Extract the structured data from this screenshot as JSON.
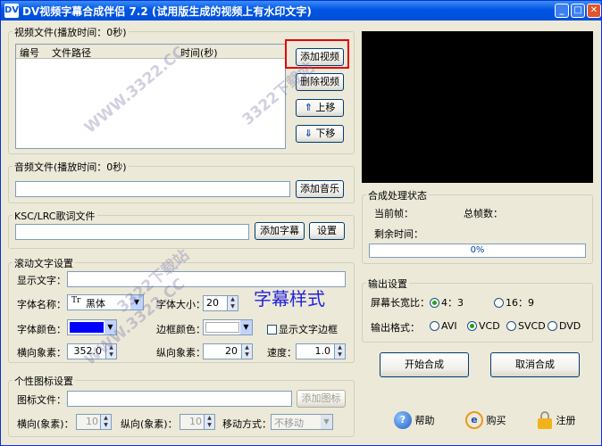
{
  "window": {
    "title": "DV视频字幕合成伴侣 7.2 (试用版生成的视频上有水印文字)",
    "min": "_",
    "max": "□",
    "close": "✕"
  },
  "video": {
    "legend": "视频文件(播放时间：0秒)",
    "col_num": "编号",
    "col_path": "文件路径",
    "col_time": "时间(秒)",
    "add": "添加视频",
    "del": "删除视频",
    "up": "上移",
    "down": "下移",
    "up_glyph": "⇑",
    "down_glyph": "⇓"
  },
  "audio": {
    "legend": "音频文件(播放时间：0秒)",
    "path": "",
    "add": "添加音乐"
  },
  "lrc": {
    "legend": "KSC/LRC歌词文件",
    "path": "",
    "add": "添加字幕",
    "settings": "设置"
  },
  "scroll": {
    "legend": "滚动文字设置",
    "text_label": "显示文字：",
    "text": "",
    "font_name_label": "字体名称：",
    "font_name": "黑体",
    "font_size_label": "字体大小：",
    "font_size": "20",
    "preview": "字幕样式",
    "font_color_label": "字体颜色：",
    "font_color": "#0000ff",
    "border_color_label": "边框颜色：",
    "border_color": "#ffffff",
    "show_border": "显示文字边框",
    "hpx_label": "横向象素：",
    "hpx": "352.0",
    "vpx_label": "纵向象素：",
    "vpx": "20",
    "speed_label": "速度：",
    "speed": "1.0"
  },
  "logo": {
    "legend": "个性图标设置",
    "file_label": "图标文件：",
    "file": "",
    "add": "添加图标",
    "h_label": "横向(象素)：",
    "h": "10",
    "v_label": "纵向(象素)：",
    "v": "10",
    "move_label": "移动方式：",
    "move": "不移动"
  },
  "status": {
    "legend": "合成处理状态",
    "cur_frame": "当前帧：",
    "total_frames": "总帧数：",
    "remaining": "剩余时间：",
    "progress": "0%",
    "progress_value": 0
  },
  "output": {
    "legend": "输出设置",
    "ratio_label": "屏幕长宽比：",
    "r43": "4：3",
    "r169": "16：9",
    "ratio": "4:3",
    "format_label": "输出格式：",
    "f_avi": "AVI",
    "f_vcd": "VCD",
    "f_svcd": "SVCD",
    "f_dvd": "DVD",
    "format": "VCD"
  },
  "actions": {
    "start": "开始合成",
    "cancel": "取消合成",
    "help": "帮助",
    "buy": "购买",
    "register": "注册"
  },
  "watermark": {
    "t1": "3322下载站",
    "t2": "WWW.3322.CC"
  }
}
